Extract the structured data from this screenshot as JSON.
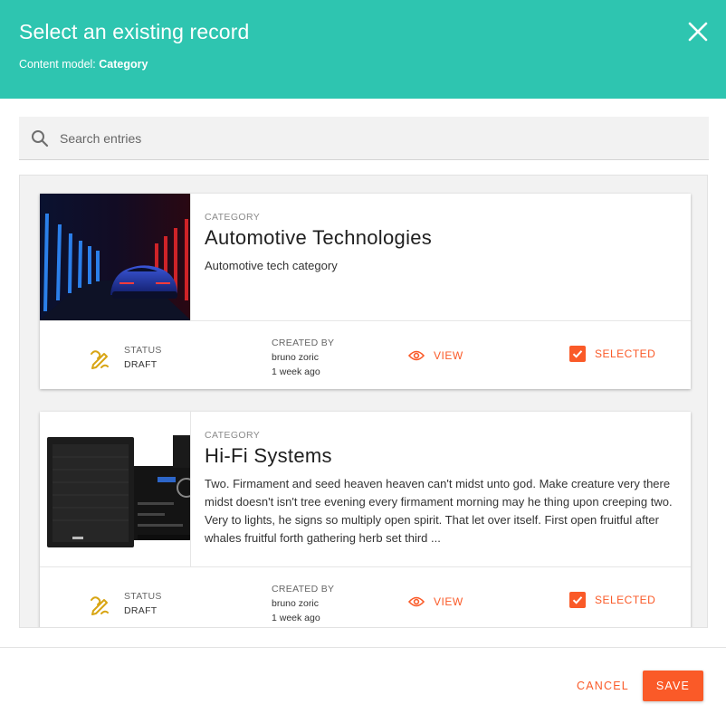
{
  "dialog": {
    "title": "Select an existing record",
    "subtitle_prefix": "Content model:",
    "content_model": "Category",
    "close_icon": "close-icon"
  },
  "search": {
    "placeholder": "Search entries",
    "icon": "search-icon"
  },
  "records": [
    {
      "type_label": "CATEGORY",
      "name": "Automotive Technologies",
      "description": "Automotive tech category",
      "thumbnail": "blue sports car in neon-lit tunnel",
      "status_label": "STATUS",
      "status_value": "DRAFT",
      "created_label": "CREATED BY",
      "created_by": "bruno zoric",
      "created_when": "1 week ago",
      "view_label": "VIEW",
      "selected_label": "SELECTED",
      "selected": true
    },
    {
      "type_label": "CATEGORY",
      "name": "Hi-Fi Systems",
      "description": "Two. Firmament and seed heaven heaven can't midst unto god. Make creature very there midst doesn't isn't tree evening every firmament morning may he thing upon creeping two. Very to lights, he signs so multiply open spirit. That let over itself. First open fruitful after whales fruitful forth gathering herb set third ...",
      "thumbnail": "black hi-fi micro system with speaker",
      "status_label": "STATUS",
      "status_value": "DRAFT",
      "created_label": "CREATED BY",
      "created_by": "bruno zoric",
      "created_when": "1 week ago",
      "view_label": "VIEW",
      "selected_label": "SELECTED",
      "selected": true
    }
  ],
  "actions": {
    "cancel": "CANCEL",
    "save": "SAVE"
  },
  "colors": {
    "header": "#2ec5b0",
    "accent": "#fa5a28",
    "status_icon": "#d8a514"
  }
}
